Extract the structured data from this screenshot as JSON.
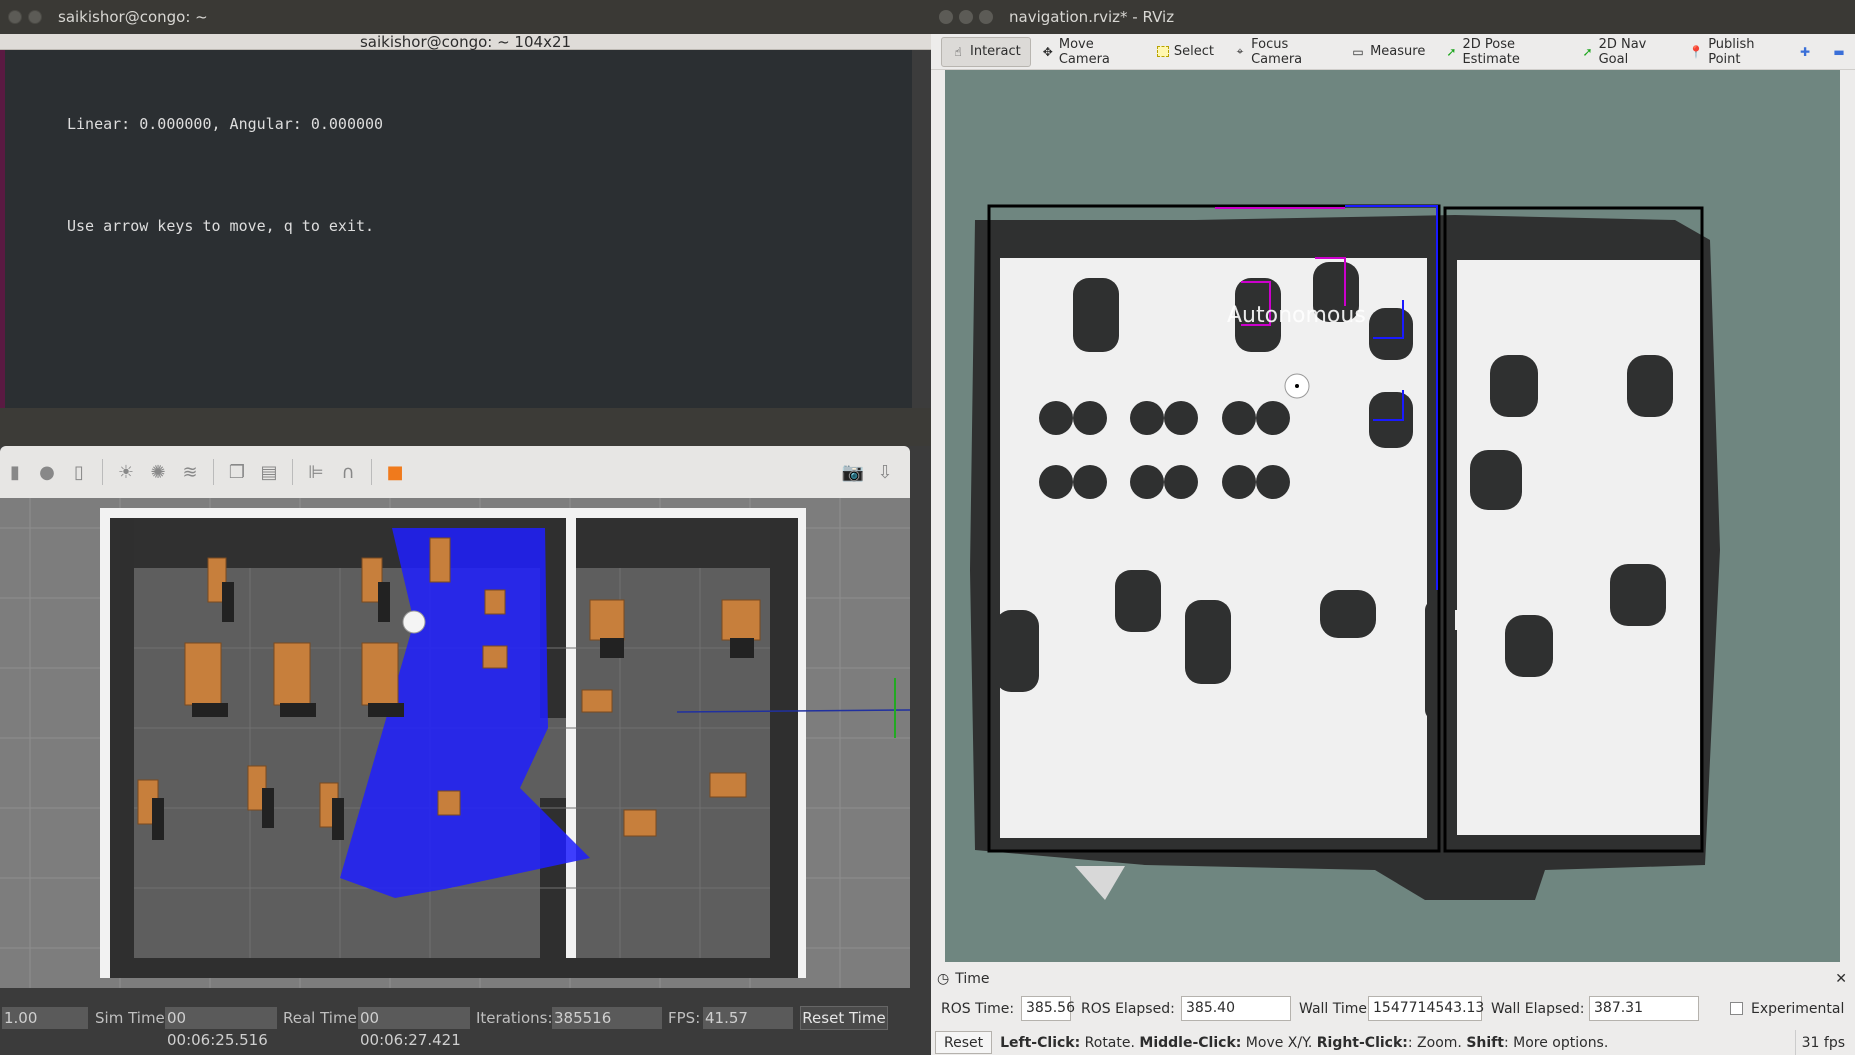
{
  "terminal": {
    "window_title": "saikishor@congo: ~",
    "subtitle": "saikishor@congo: ~ 104x21",
    "line1": "Linear: 0.000000, Angular: 0.000000",
    "line2": "Use arrow keys to move, q to exit."
  },
  "gazebo": {
    "toolbar_icons": [
      "box-icon",
      "sphere-icon",
      "cylinder-icon",
      "sun-icon",
      "point-light-icon",
      "spot-light-icon",
      "copy-icon",
      "paste-icon",
      "align-icon",
      "magnet-icon",
      "color-icon",
      "camera-icon",
      "log-icon"
    ],
    "status": {
      "rtf_value": "1.00",
      "sim_time_label": "Sim Time:",
      "sim_time_value": "00 00:06:25.516",
      "real_time_label": "Real Time:",
      "real_time_value": "00 00:06:27.421",
      "iterations_label": "Iterations:",
      "iterations_value": "385516",
      "fps_label": "FPS:",
      "fps_value": "41.57",
      "reset_label": "Reset Time"
    }
  },
  "rviz": {
    "window_title": "navigation.rviz* - RViz",
    "tools": [
      {
        "name": "interact",
        "label": "Interact",
        "icon": "cursor-icon",
        "active": true
      },
      {
        "name": "move-camera",
        "label": "Move Camera",
        "icon": "move-camera-icon",
        "active": false
      },
      {
        "name": "select",
        "label": "Select",
        "icon": "select-icon",
        "active": false
      },
      {
        "name": "focus-camera",
        "label": "Focus Camera",
        "icon": "focus-camera-icon",
        "active": false
      },
      {
        "name": "measure",
        "label": "Measure",
        "icon": "ruler-icon",
        "active": false
      },
      {
        "name": "2d-pose-estimate",
        "label": "2D Pose Estimate",
        "icon": "green-arrow-icon",
        "active": false
      },
      {
        "name": "2d-nav-goal",
        "label": "2D Nav Goal",
        "icon": "green-arrow-icon",
        "active": false
      },
      {
        "name": "publish-point",
        "label": "Publish Point",
        "icon": "map-pin-icon",
        "active": false
      }
    ],
    "map_overlay_text": "Autonomous",
    "time_panel_title": "Time",
    "time": {
      "ros_time_label": "ROS Time:",
      "ros_time_value": "385.56",
      "ros_elapsed_label": "ROS Elapsed:",
      "ros_elapsed_value": "385.40",
      "wall_time_label": "Wall Time:",
      "wall_time_value": "1547714543.13",
      "wall_elapsed_label": "Wall Elapsed:",
      "wall_elapsed_value": "387.31",
      "experimental_label": "Experimental"
    },
    "status_bar": {
      "reset_label": "Reset",
      "hint_left_click": "Left-Click:",
      "hint_left_action": " Rotate. ",
      "hint_middle_click": "Middle-Click:",
      "hint_middle_action": " Move X/Y. ",
      "hint_right_click": "Right-Click:",
      "hint_right_action": ": Zoom. ",
      "hint_shift": "Shift",
      "hint_shift_action": ": More options.",
      "fps": "31 fps"
    },
    "colors": {
      "map_background": "#6f8680",
      "free_space": "#f0f0f0",
      "obstacle": "#2f3030",
      "laser": "#1a1aff",
      "path": "#cc00cc"
    }
  }
}
